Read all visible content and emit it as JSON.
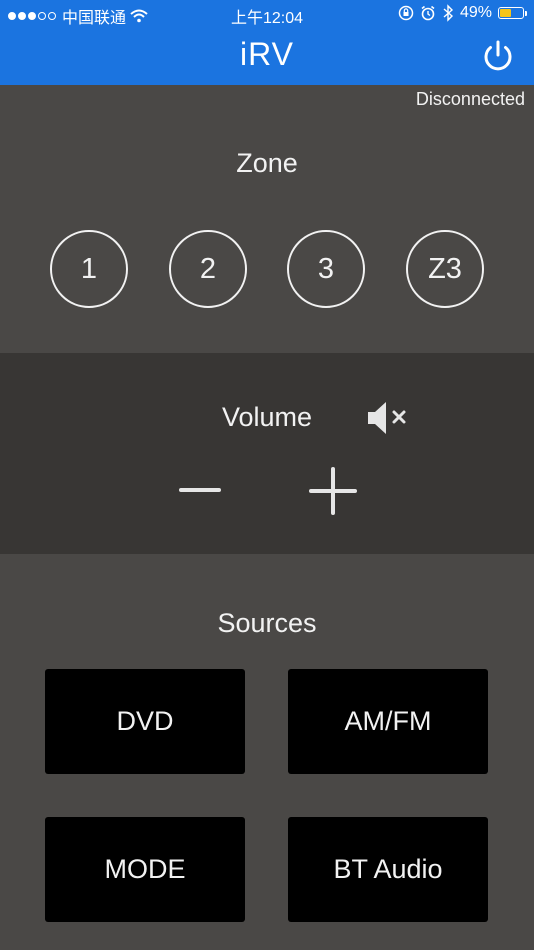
{
  "status_bar": {
    "carrier": "中国联通",
    "time": "上午12:04",
    "battery_percent": "49%",
    "battery_level": 0.49,
    "battery_color": "#f5c518",
    "icons": [
      "signal-dots-icon",
      "wifi-icon",
      "orientation-lock-icon",
      "alarm-icon",
      "bluetooth-icon",
      "battery-icon"
    ]
  },
  "nav": {
    "title": "iRV",
    "power_icon": "power-icon",
    "accent_color": "#1b74e0"
  },
  "connection": {
    "status": "Disconnected"
  },
  "zone": {
    "heading": "Zone",
    "buttons": [
      "1",
      "2",
      "3",
      "Z3"
    ]
  },
  "volume": {
    "heading": "Volume",
    "mute_icon": "speaker-mute-icon",
    "minus_icon": "minus-icon",
    "plus_icon": "plus-icon"
  },
  "sources": {
    "heading": "Sources",
    "buttons": [
      "DVD",
      "AM/FM",
      "MODE",
      "BT Audio"
    ]
  }
}
